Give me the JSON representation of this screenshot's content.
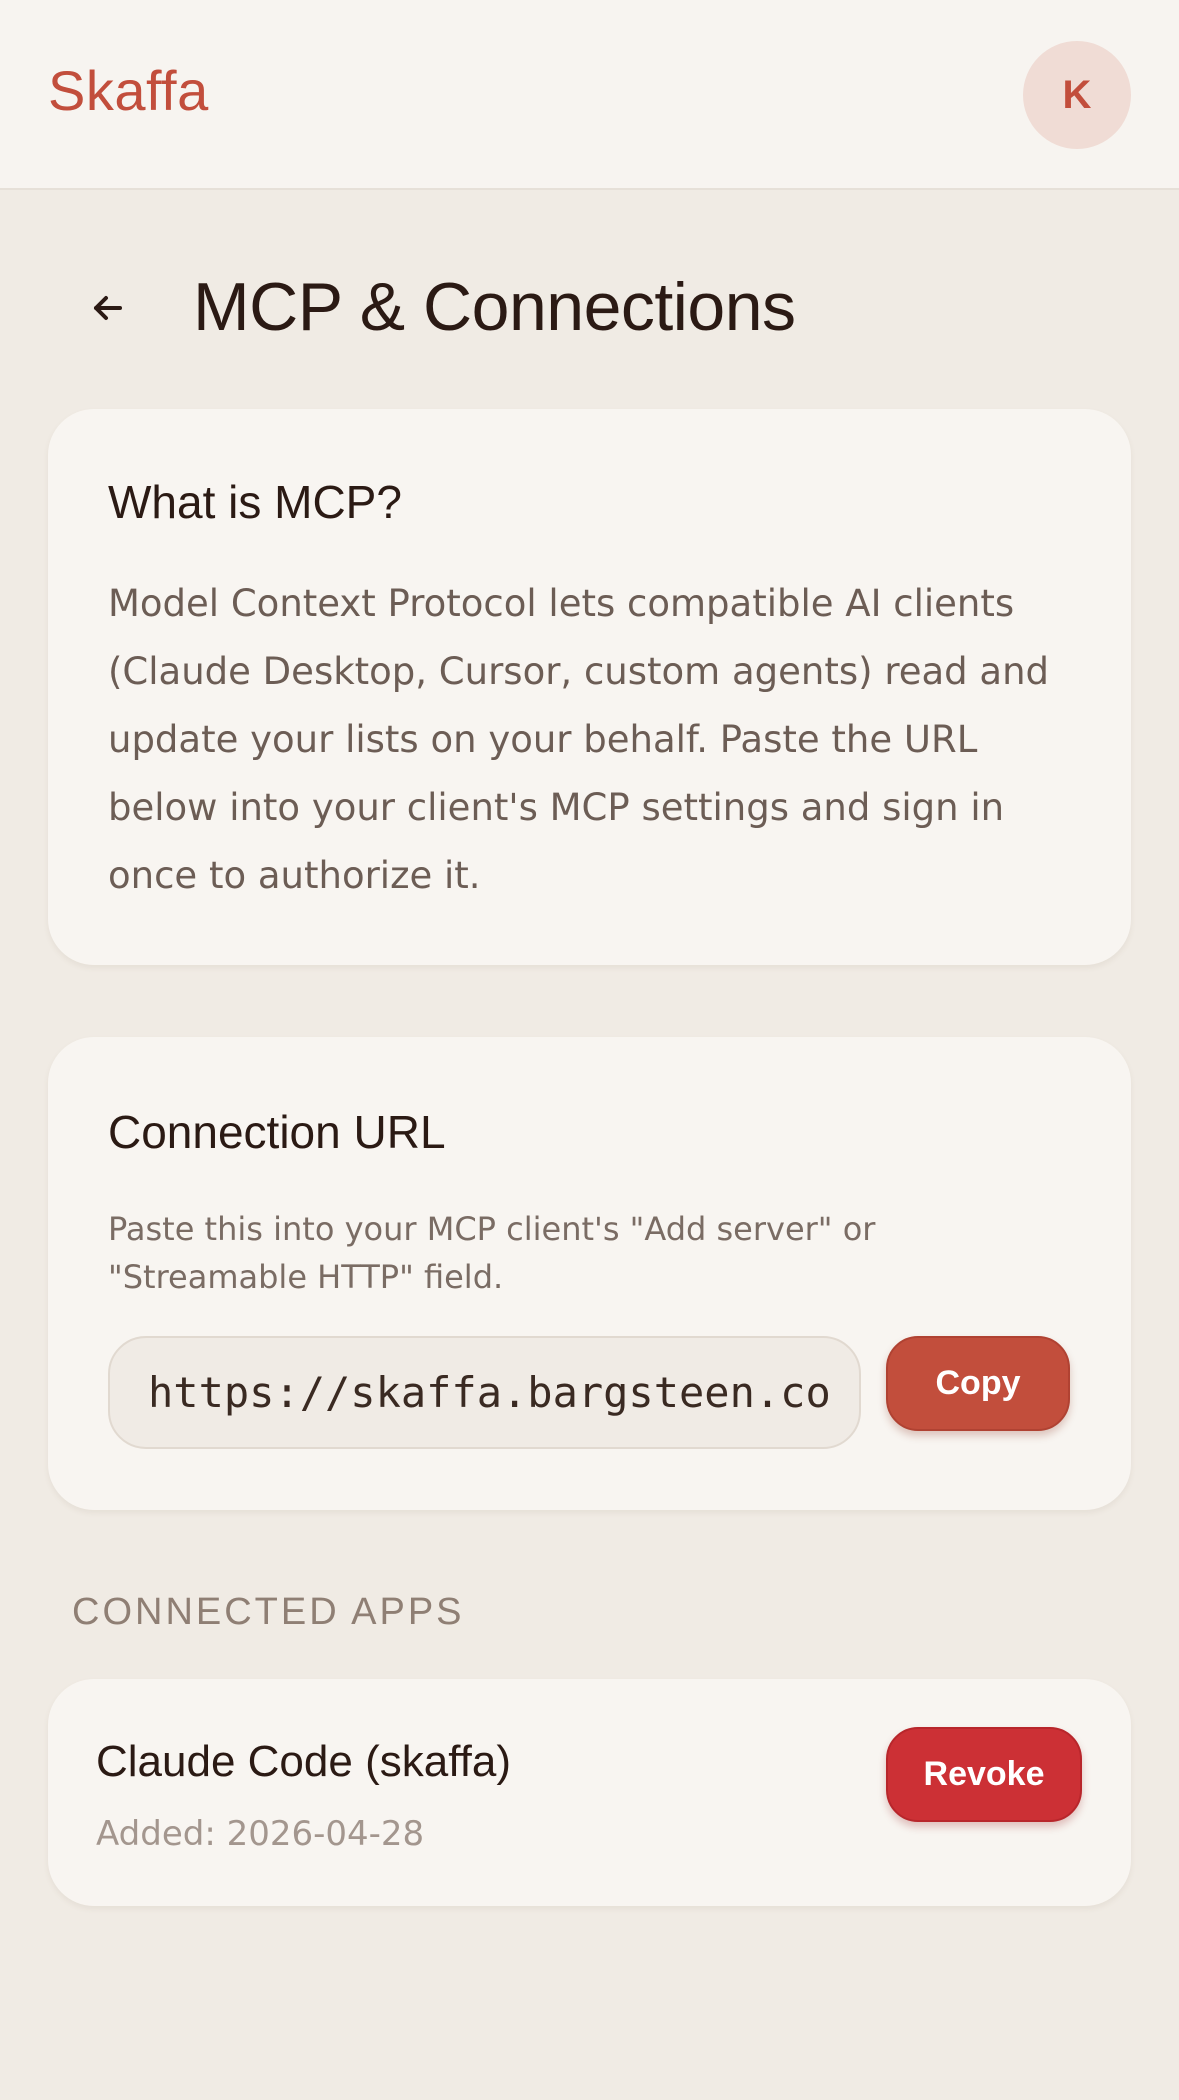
{
  "header": {
    "brand": "Skaffa",
    "avatar_initial": "K"
  },
  "page": {
    "title": "MCP & Connections"
  },
  "about_card": {
    "title": "What is MCP?",
    "body": "Model Context Protocol lets compatible AI clients (Claude Desktop, Cursor, custom agents) read and update your lists on your behalf. Paste the URL below into your client's MCP settings and sign in once to authorize it."
  },
  "connection_card": {
    "title": "Connection URL",
    "description": "Paste this into your MCP client's \"Add server\" or \"Streamable HTTP\" field.",
    "url_value": "https://skaffa.bargsteen.co",
    "copy_label": "Copy"
  },
  "connected_apps": {
    "section_label": "CONNECTED APPS",
    "items": [
      {
        "name": "Claude Code (skaffa)",
        "added": "Added: 2026-04-28",
        "revoke_label": "Revoke"
      }
    ]
  },
  "colors": {
    "accent": "#c24e3c",
    "danger": "#cc3035",
    "background": "#f0ebe4",
    "card": "#f8f5f1"
  },
  "icons": {
    "back": "arrow-left-icon"
  }
}
